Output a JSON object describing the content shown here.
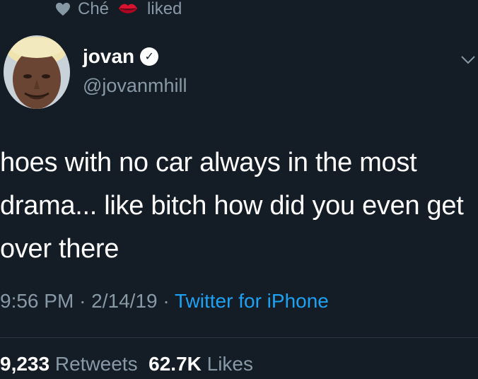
{
  "social_context": {
    "actor": "Ché",
    "action": "liked"
  },
  "author": {
    "name": "jovan",
    "handle": "@jovanmhill"
  },
  "tweet": {
    "text_lines": [
      "hoes with no car always in the most",
      "drama... like bitch how did you even get",
      "over there"
    ]
  },
  "meta": {
    "time": "9:56 PM",
    "date": "2/14/19",
    "separator": "·",
    "source": "Twitter for iPhone"
  },
  "stats": {
    "retweets_count": "9,233",
    "retweets_label": "Retweets",
    "likes_count": "62.7K",
    "likes_label": "Likes"
  },
  "colors": {
    "background": "#141d26",
    "secondary_text": "#8899a6",
    "link": "#1da1f2"
  },
  "icons": {
    "liked": "heart-icon",
    "emoji": "lips-icon",
    "verified": "verified-badge-icon",
    "menu": "chevron-down-icon"
  }
}
